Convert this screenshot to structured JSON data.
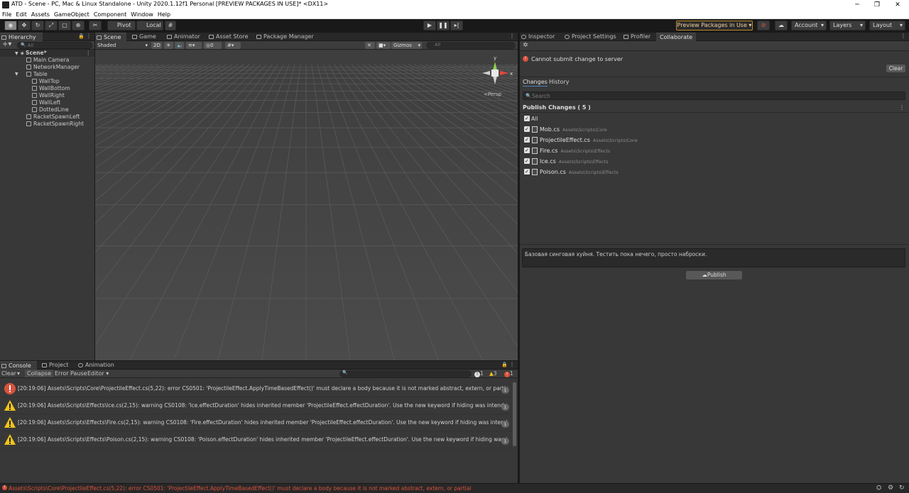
{
  "window": {
    "title": "ATD - Scene - PC, Mac & Linux Standalone - Unity 2020.1.12f1 Personal [PREVIEW PACKAGES IN USE]* <DX11>"
  },
  "menu": [
    "File",
    "Edit",
    "Assets",
    "GameObject",
    "Component",
    "Window",
    "Help"
  ],
  "toolbar": {
    "pivot": "Pivot",
    "local": "Local",
    "preview_packages": "Preview Packages in Use",
    "account": "Account",
    "layers": "Layers",
    "layout": "Layout"
  },
  "hierarchy": {
    "tab": "Hierarchy",
    "search_placeholder": "All",
    "scene": "Scene*",
    "items": [
      {
        "name": "Main Camera",
        "depth": 1
      },
      {
        "name": "NetworkManager",
        "depth": 1
      },
      {
        "name": "Table",
        "depth": 1,
        "expanded": true
      },
      {
        "name": "WallTop",
        "depth": 2
      },
      {
        "name": "WallBottom",
        "depth": 2
      },
      {
        "name": "WallRight",
        "depth": 2
      },
      {
        "name": "WallLeft",
        "depth": 2
      },
      {
        "name": "DottedLine",
        "depth": 2
      },
      {
        "name": "RacketSpawnLeft",
        "depth": 1
      },
      {
        "name": "RacketSpawnRight",
        "depth": 1
      }
    ]
  },
  "scene_tabs": [
    "Scene",
    "Game",
    "Animator",
    "Asset Store",
    "Package Manager"
  ],
  "scene_bar": {
    "shading": "Shaded",
    "mode_2d": "2D",
    "fx_count": "0",
    "gizmos": "Gizmos",
    "search_placeholder": "All"
  },
  "gizmo": {
    "y": "y",
    "x": "x",
    "persp": "Persp"
  },
  "console": {
    "tabs": [
      "Console",
      "Project",
      "Animation"
    ],
    "clear": "Clear",
    "collapse": "Collapse",
    "error_pause": "Error Pause",
    "editor": "Editor",
    "counts": {
      "info": "1",
      "warn": "3",
      "error": "1"
    },
    "rows": [
      {
        "level": "error",
        "text": "[20:19:06] Assets\\Scripts\\Core\\ProjectileEffect.cs(5,22): error CS0501: 'ProjectileEffect.ApplyTimeBasedEffect()' must declare a body because it is not marked abstract, extern, or partial",
        "count": "1"
      },
      {
        "level": "warning",
        "text": "[20:19:06] Assets\\Scripts\\Effects\\Ice.cs(2,15): warning CS0108: 'Ice.effectDuration' hides inherited member 'ProjectileEffect.effectDuration'. Use the new keyword if hiding was intended.",
        "count": "1"
      },
      {
        "level": "warning",
        "text": "[20:19:06] Assets\\Scripts\\Effects\\Fire.cs(2,15): warning CS0108: 'Fire.effectDuration' hides inherited member 'ProjectileEffect.effectDuration'. Use the new keyword if hiding was intended.",
        "count": "1"
      },
      {
        "level": "warning",
        "text": "[20:19:06] Assets\\Scripts\\Effects\\Poison.cs(2,15): warning CS0108: 'Poison.effectDuration' hides inherited member 'ProjectileEffect.effectDuration'. Use the new keyword if hiding was intended.",
        "count": "1"
      }
    ]
  },
  "right_tabs": [
    "Inspector",
    "Project Settings",
    "Profiler",
    "Collaborate"
  ],
  "collab": {
    "error_msg": "Cannot submit change to server",
    "clear": "Clear",
    "tabs": [
      "Changes",
      "History"
    ],
    "search_placeholder": "Search",
    "publish_header": "Publish Changes ( 5 )",
    "all": "All",
    "files": [
      {
        "name": "Mob.cs",
        "path": "Assets\\Scripts\\Core"
      },
      {
        "name": "ProjectileEffect.cs",
        "path": "Assets\\Scripts\\Core"
      },
      {
        "name": "Fire.cs",
        "path": "Assets\\Scripts\\Effects"
      },
      {
        "name": "Ice.cs",
        "path": "Assets\\Scripts\\Effects"
      },
      {
        "name": "Poison.cs",
        "path": "Assets\\Scripts\\Effects"
      }
    ],
    "comment": "Базовая синговая хуйня. Тестить пока нечего, просто наброски.",
    "publish": "Publish"
  },
  "status": {
    "text": "Assets\\Scripts\\Core\\ProjectileEffect.cs(5,22): error CS0501: 'ProjectileEffect.ApplyTimeBasedEffect()' must declare a body because it is not marked abstract, extern, or partial"
  },
  "colors": {
    "error": "#d9523b",
    "warning": "#f0c419",
    "accent": "#4d80c4",
    "preview_border": "#c08a2a"
  }
}
